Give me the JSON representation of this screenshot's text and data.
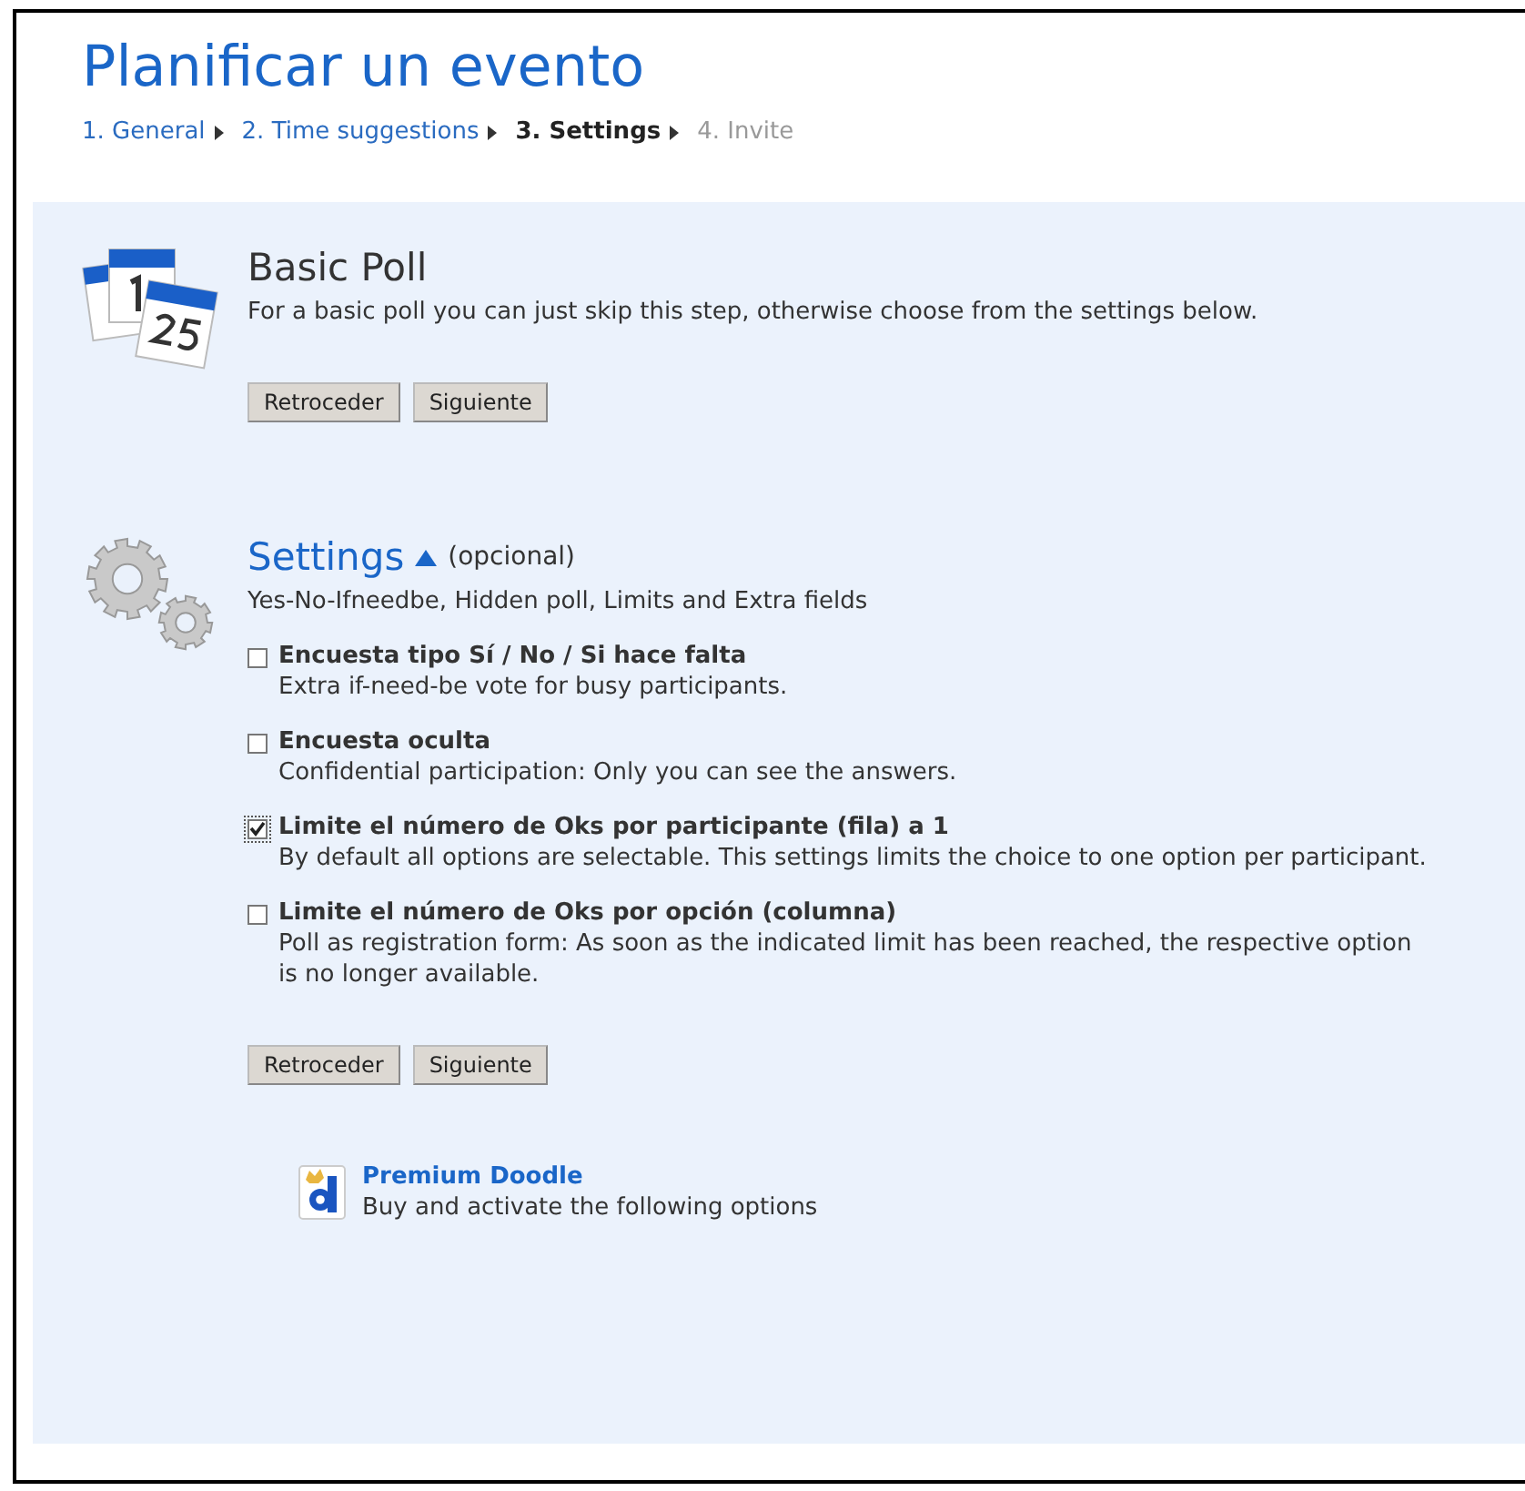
{
  "title": "Planificar un evento",
  "steps": [
    {
      "label": "1. General",
      "selected": false,
      "disabled": false
    },
    {
      "label": "2. Time suggestions",
      "selected": false,
      "disabled": false
    },
    {
      "label": "3. Settings",
      "selected": true,
      "disabled": false
    },
    {
      "label": "4. Invite",
      "selected": false,
      "disabled": true
    }
  ],
  "basic_poll": {
    "heading": "Basic Poll",
    "text": "For a basic poll you can just skip this step, otherwise choose from the settings below.",
    "buttons": [
      "Retroceder",
      "Siguiente"
    ]
  },
  "settings": {
    "heading": "Settings",
    "expanded": true,
    "optional": "(opcional)",
    "summary": "Yes-No-Ifneedbe, Hidden poll, Limits and Extra fields",
    "options": [
      {
        "label": "Encuesta tipo Sí / No / Si hace falta",
        "description": "Extra if-need-be vote for busy participants.",
        "checked": false
      },
      {
        "label": "Encuesta oculta",
        "description": "Confidential participation: Only you can see the answers.",
        "checked": false
      },
      {
        "label": "Limite el número de Oks por participante (fila) a 1",
        "description": "By default all options are selectable. This settings limits the choice to one option per participant.",
        "checked": true
      },
      {
        "label": "Limite el número de Oks por opción (columna)",
        "description": "Poll as registration form: As soon as the indicated limit has been reached, the respective option is no longer available.",
        "checked": false
      }
    ],
    "buttons": [
      "Retroceder",
      "Siguiente"
    ]
  },
  "premium": {
    "heading": "Premium Doodle",
    "text": "Buy and activate the following options"
  }
}
